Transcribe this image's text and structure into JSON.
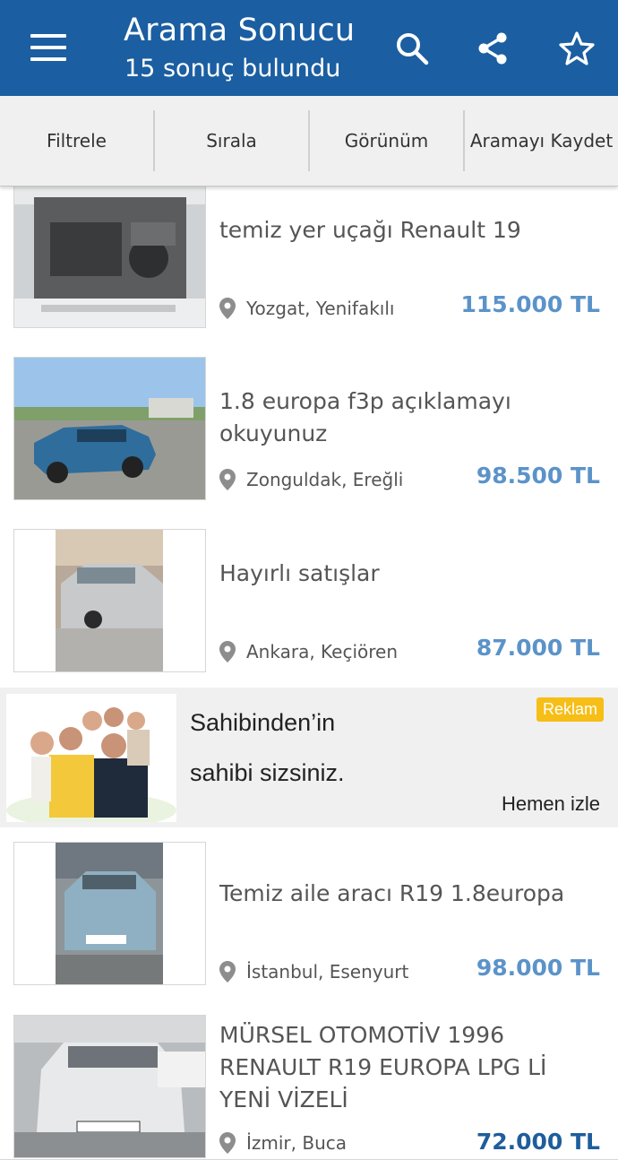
{
  "header": {
    "title": "Arama Sonucu",
    "subtitle": "15 sonuç bulundu",
    "icons": [
      "menu-icon",
      "search-icon",
      "share-icon",
      "star-icon"
    ]
  },
  "toolbar": {
    "filter": "Filtrele",
    "sort": "Sırala",
    "view": "Görünüm",
    "save": "Aramayı Kaydet"
  },
  "listings": [
    {
      "title": "temiz yer uçağı Renault 19",
      "location": "Yozgat, Yenifakılı",
      "price": "115.000 TL"
    },
    {
      "title": "1.8 europa f3p açıklamayı okuyunuz",
      "location": "Zonguldak, Ereğli",
      "price": "98.500 TL"
    },
    {
      "title": "Hayırlı satışlar",
      "location": "Ankara, Keçiören",
      "price": "87.000 TL"
    },
    {
      "title": "Temiz aile aracı R19 1.8europa",
      "location": "İstanbul, Esenyurt",
      "price": "98.000 TL"
    },
    {
      "title": "MÜRSEL OTOMOTİV 1996 RENAULT R19 EUROPA LPG Lİ YENİ VİZELİ",
      "location": "İzmir, Buca",
      "price": "72.000 TL"
    }
  ],
  "ad": {
    "line1": "Sahibinden’in",
    "line2": "sahibi sizsiniz.",
    "badge": "Reklam",
    "cta": "Hemen izle"
  },
  "colors": {
    "header": "#1b5ea1",
    "price": "#5b93c9",
    "badge": "#f6be17"
  }
}
